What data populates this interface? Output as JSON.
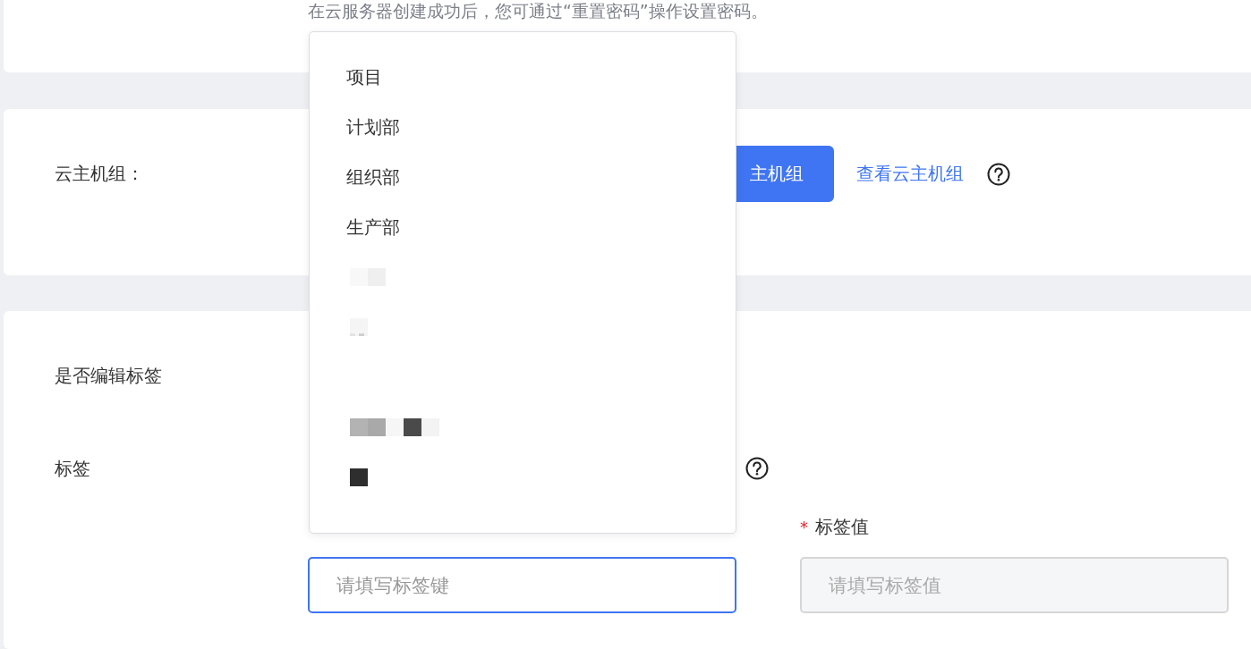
{
  "password_note": "在云服务器创建成功后，您可通过“重置密码”操作设置密码。",
  "host_group": {
    "label": "云主机组：",
    "button": "主机组",
    "link": "查看云主机组"
  },
  "tags": {
    "edit_label": "是否编辑标签",
    "label": "标签",
    "key_field": {
      "placeholder": "请填写标签键",
      "focused": true,
      "disabled": false
    },
    "value_label": "标签值",
    "required_mark": "*",
    "value_field": {
      "placeholder": "请填写标签值",
      "focused": false,
      "disabled": true
    }
  },
  "dropdown": {
    "items": [
      {
        "kind": "text",
        "label": "项目"
      },
      {
        "kind": "text",
        "label": "计划部"
      },
      {
        "kind": "text",
        "label": "组织部"
      },
      {
        "kind": "text",
        "label": "生产部"
      },
      {
        "kind": "redacted"
      },
      {
        "kind": "redacted"
      },
      {
        "kind": "blank"
      },
      {
        "kind": "redacted"
      },
      {
        "kind": "redacted"
      }
    ]
  }
}
